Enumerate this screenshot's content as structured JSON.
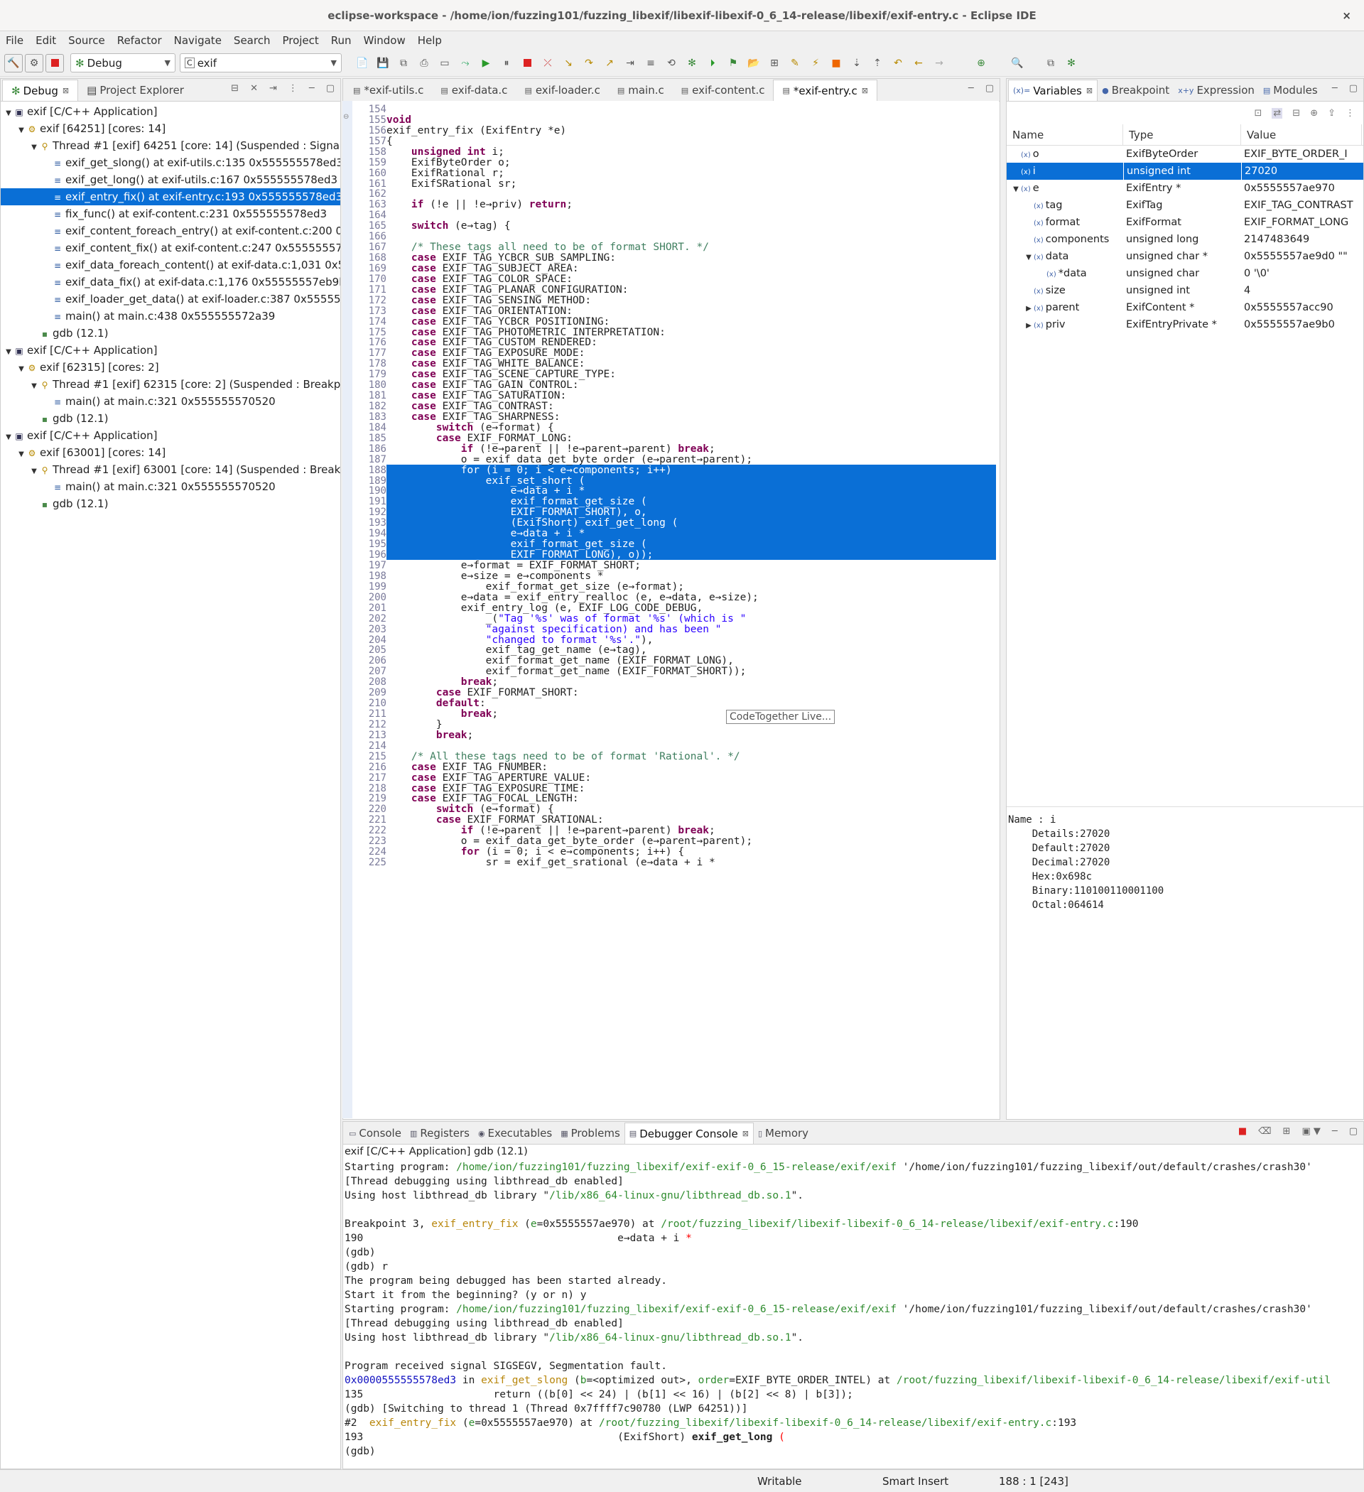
{
  "window": {
    "title": "eclipse-workspace - /home/ion/fuzzing101/fuzzing_libexif/libexif-libexif-0_6_14-release/libexif/exif-entry.c - Eclipse IDE",
    "close": "×"
  },
  "menu": [
    "File",
    "Edit",
    "Source",
    "Refactor",
    "Navigate",
    "Search",
    "Project",
    "Run",
    "Window",
    "Help"
  ],
  "toolbar": {
    "perspective": "Debug",
    "launch_config": "exif"
  },
  "debug_view": {
    "tabs": [
      "Debug",
      "Project Explorer"
    ],
    "rows": [
      {
        "indent": 0,
        "twisty": "▼",
        "icon": "c-app-icon",
        "text": "exif [C/C++ Application]"
      },
      {
        "indent": 1,
        "twisty": "▼",
        "icon": "process-icon",
        "text": "exif [64251] [cores: 14]"
      },
      {
        "indent": 2,
        "twisty": "▼",
        "icon": "thread-icon",
        "text": "Thread #1 [exif] 64251 [core: 14] (Suspended : Signal"
      },
      {
        "indent": 3,
        "twisty": "",
        "icon": "frame-icon",
        "text": "exif_get_slong() at exif-utils.c:135 0x555555578ed3"
      },
      {
        "indent": 3,
        "twisty": "",
        "icon": "frame-icon",
        "text": "exif_get_long() at exif-utils.c:167 0x555555578ed3"
      },
      {
        "indent": 3,
        "twisty": "",
        "icon": "frame-icon",
        "text": "exif_entry_fix() at exif-entry.c:193 0x555555578ed3",
        "selected": true
      },
      {
        "indent": 3,
        "twisty": "",
        "icon": "frame-icon",
        "text": "fix_func() at exif-content.c:231 0x555555578ed3"
      },
      {
        "indent": 3,
        "twisty": "",
        "icon": "frame-icon",
        "text": "exif_content_foreach_entry() at exif-content.c:200 0x"
      },
      {
        "indent": 3,
        "twisty": "",
        "icon": "frame-icon",
        "text": "exif_content_fix() at exif-content.c:247 0x555555578"
      },
      {
        "indent": 3,
        "twisty": "",
        "icon": "frame-icon",
        "text": "exif_data_foreach_content() at exif-data.c:1,031 0x55"
      },
      {
        "indent": 3,
        "twisty": "",
        "icon": "frame-icon",
        "text": "exif_data_fix() at exif-data.c:1,176 0x55555557eb9b"
      },
      {
        "indent": 3,
        "twisty": "",
        "icon": "frame-icon",
        "text": "exif_loader_get_data() at exif-loader.c:387 0x555555"
      },
      {
        "indent": 3,
        "twisty": "",
        "icon": "frame-icon",
        "text": "main() at main.c:438 0x555555572a39"
      },
      {
        "indent": 2,
        "twisty": "",
        "icon": "gdb-icon",
        "text": "gdb (12.1)"
      },
      {
        "indent": 0,
        "twisty": "▼",
        "icon": "c-app-icon",
        "text": "exif [C/C++ Application]"
      },
      {
        "indent": 1,
        "twisty": "▼",
        "icon": "process-icon",
        "text": "exif [62315] [cores: 2]"
      },
      {
        "indent": 2,
        "twisty": "▼",
        "icon": "thread-icon",
        "text": "Thread #1 [exif] 62315 [core: 2] (Suspended : Breakpo"
      },
      {
        "indent": 3,
        "twisty": "",
        "icon": "frame-icon",
        "text": "main() at main.c:321 0x555555570520"
      },
      {
        "indent": 2,
        "twisty": "",
        "icon": "gdb-icon",
        "text": "gdb (12.1)"
      },
      {
        "indent": 0,
        "twisty": "▼",
        "icon": "c-app-icon",
        "text": "exif [C/C++ Application]"
      },
      {
        "indent": 1,
        "twisty": "▼",
        "icon": "process-icon",
        "text": "exif [63001] [cores: 14]"
      },
      {
        "indent": 2,
        "twisty": "▼",
        "icon": "thread-icon",
        "text": "Thread #1 [exif] 63001 [core: 14] (Suspended : Breakp"
      },
      {
        "indent": 3,
        "twisty": "",
        "icon": "frame-icon",
        "text": "main() at main.c:321 0x555555570520"
      },
      {
        "indent": 2,
        "twisty": "",
        "icon": "gdb-icon",
        "text": "gdb (12.1)"
      }
    ]
  },
  "editor": {
    "tabs": [
      {
        "label": "*exif-utils.c",
        "active": false
      },
      {
        "label": "exif-data.c",
        "active": false
      },
      {
        "label": "exif-loader.c",
        "active": false
      },
      {
        "label": "main.c",
        "active": false
      },
      {
        "label": "exif-content.c",
        "active": false
      },
      {
        "label": "*exif-entry.c",
        "active": true
      }
    ],
    "first_line": 154,
    "highlight": {
      "from": 188,
      "to": 196
    },
    "lines": [
      "",
      "void",
      "exif_entry_fix (ExifEntry *e)",
      "{",
      "    unsigned int i;",
      "    ExifByteOrder o;",
      "    ExifRational r;",
      "    ExifSRational sr;",
      "",
      "    if (!e || !e→priv) return;",
      "",
      "    switch (e→tag) {",
      "",
      "    /* These tags all need to be of format SHORT. */",
      "    case EXIF_TAG_YCBCR_SUB_SAMPLING:",
      "    case EXIF_TAG_SUBJECT_AREA:",
      "    case EXIF_TAG_COLOR_SPACE:",
      "    case EXIF_TAG_PLANAR_CONFIGURATION:",
      "    case EXIF_TAG_SENSING_METHOD:",
      "    case EXIF_TAG_ORIENTATION:",
      "    case EXIF_TAG_YCBCR_POSITIONING:",
      "    case EXIF_TAG_PHOTOMETRIC_INTERPRETATION:",
      "    case EXIF_TAG_CUSTOM_RENDERED:",
      "    case EXIF_TAG_EXPOSURE_MODE:",
      "    case EXIF_TAG_WHITE_BALANCE:",
      "    case EXIF_TAG_SCENE_CAPTURE_TYPE:",
      "    case EXIF_TAG_GAIN_CONTROL:",
      "    case EXIF_TAG_SATURATION:",
      "    case EXIF_TAG_CONTRAST:",
      "    case EXIF_TAG_SHARPNESS:",
      "        switch (e→format) {",
      "        case EXIF_FORMAT_LONG:",
      "            if (!e→parent || !e→parent→parent) break;",
      "            o = exif_data_get_byte_order (e→parent→parent);",
      "            for (i = 0; i < e→components; i++)",
      "                exif_set_short (",
      "                    e→data + i *",
      "                    exif_format_get_size (",
      "                    EXIF_FORMAT_SHORT), o,",
      "                    (ExifShort) exif_get_long (",
      "                    e→data + i *",
      "                    exif_format_get_size (",
      "                    EXIF_FORMAT_LONG), o));",
      "            e→format = EXIF_FORMAT_SHORT;",
      "            e→size = e→components *",
      "                exif_format_get_size (e→format);",
      "            e→data = exif_entry_realloc (e, e→data, e→size);",
      "            exif_entry_log (e, EXIF_LOG_CODE_DEBUG,",
      "                _(\"Tag '%s' was of format '%s' (which is \"",
      "                \"against specification) and has been \"",
      "                \"changed to format '%s'.\"),",
      "                exif_tag_get_name (e→tag),",
      "                exif_format_get_name (EXIF_FORMAT_LONG),",
      "                exif_format_get_name (EXIF_FORMAT_SHORT));",
      "            break;",
      "        case EXIF_FORMAT_SHORT:",
      "        default:",
      "            break;",
      "        }",
      "        break;",
      "",
      "    /* All these tags need to be of format 'Rational'. */",
      "    case EXIF_TAG_FNUMBER:",
      "    case EXIF_TAG_APERTURE_VALUE:",
      "    case EXIF_TAG_EXPOSURE_TIME:",
      "    case EXIF_TAG_FOCAL_LENGTH:",
      "        switch (e→format) {",
      "        case EXIF_FORMAT_SRATIONAL:",
      "            if (!e→parent || !e→parent→parent) break;",
      "            o = exif_data_get_byte_order (e→parent→parent);",
      "            for (i = 0; i < e→components; i++) {",
      "                sr = exif_get_srational (e→data + i *"
    ],
    "hover_tip": "CodeTogether Live..."
  },
  "variables_view": {
    "tabs": [
      "Variables",
      "Breakpoint",
      "Expression",
      "Modules"
    ],
    "columns": [
      "Name",
      "Type",
      "Value"
    ],
    "rows": [
      {
        "indent": 0,
        "twisty": "",
        "name": "o",
        "type": "ExifByteOrder",
        "value": "EXIF_BYTE_ORDER_I"
      },
      {
        "indent": 0,
        "twisty": "",
        "name": "i",
        "type": "unsigned int",
        "value": "27020",
        "selected": true
      },
      {
        "indent": 0,
        "twisty": "▼",
        "name": "e",
        "type": "ExifEntry *",
        "value": "0x5555557ae970"
      },
      {
        "indent": 1,
        "twisty": "",
        "name": "tag",
        "type": "ExifTag",
        "value": "EXIF_TAG_CONTRAST"
      },
      {
        "indent": 1,
        "twisty": "",
        "name": "format",
        "type": "ExifFormat",
        "value": "EXIF_FORMAT_LONG"
      },
      {
        "indent": 1,
        "twisty": "",
        "name": "components",
        "type": "unsigned long",
        "value": "2147483649"
      },
      {
        "indent": 1,
        "twisty": "▼",
        "name": "data",
        "type": "unsigned char *",
        "value": "0x5555557ae9d0 \"\""
      },
      {
        "indent": 2,
        "twisty": "",
        "name": "*data",
        "type": "unsigned char",
        "value": "0 '\\0'"
      },
      {
        "indent": 1,
        "twisty": "",
        "name": "size",
        "type": "unsigned int",
        "value": "4"
      },
      {
        "indent": 1,
        "twisty": "▶",
        "name": "parent",
        "type": "ExifContent *",
        "value": "0x5555557acc90"
      },
      {
        "indent": 1,
        "twisty": "▶",
        "name": "priv",
        "type": "ExifEntryPrivate *",
        "value": "0x5555557ae9b0"
      }
    ],
    "details": [
      "Name : i",
      "    Details:27020",
      "    Default:27020",
      "    Decimal:27020",
      "    Hex:0x698c",
      "    Binary:110100110001100",
      "    Octal:064614"
    ]
  },
  "console_view": {
    "tabs": [
      "Console",
      "Registers",
      "Executables",
      "Problems",
      "Debugger Console",
      "Memory"
    ],
    "active_tab": "Debugger Console",
    "header": "exif [C/C++ Application] gdb (12.1)",
    "lines": [
      [
        [
          "Starting program: ",
          ""
        ],
        [
          "/home/ion/fuzzing101/fuzzing_libexif/exif-exif-0_6_15-release/exif/exif",
          "path"
        ],
        [
          " '/home/ion/fuzzing101/fuzzing_libexif/out/default/crashes/crash30'",
          ""
        ]
      ],
      [
        [
          "[Thread debugging using libthread_db enabled]",
          ""
        ]
      ],
      [
        [
          "Using host libthread_db library \"",
          ""
        ],
        [
          "/lib/x86_64-linux-gnu/libthread_db.so.1",
          "path"
        ],
        [
          "\".",
          ""
        ]
      ],
      [
        [
          "",
          ""
        ]
      ],
      [
        [
          "Breakpoint 3, ",
          ""
        ],
        [
          "exif_entry_fix",
          "fn"
        ],
        [
          " (",
          ""
        ],
        [
          "e",
          "path"
        ],
        [
          "=0x5555557ae970) at ",
          ""
        ],
        [
          "/root/fuzzing_libexif/libexif-libexif-0_6_14-release/libexif/exif-entry.c",
          "path"
        ],
        [
          ":190",
          ""
        ]
      ],
      [
        [
          "190                                         e→data + i ",
          ""
        ],
        [
          "*",
          "num"
        ]
      ],
      [
        [
          "(gdb)",
          ""
        ]
      ],
      [
        [
          "(gdb) r",
          ""
        ]
      ],
      [
        [
          "The program being debugged has been started already.",
          ""
        ]
      ],
      [
        [
          "Start it from the beginning? (y or n) y",
          ""
        ]
      ],
      [
        [
          "Starting program: ",
          ""
        ],
        [
          "/home/ion/fuzzing101/fuzzing_libexif/exif-exif-0_6_15-release/exif/exif",
          "path"
        ],
        [
          " '/home/ion/fuzzing101/fuzzing_libexif/out/default/crashes/crash30'",
          ""
        ]
      ],
      [
        [
          "[Thread debugging using libthread_db enabled]",
          ""
        ]
      ],
      [
        [
          "Using host libthread_db library \"",
          ""
        ],
        [
          "/lib/x86_64-linux-gnu/libthread_db.so.1",
          "path"
        ],
        [
          "\".",
          ""
        ]
      ],
      [
        [
          "",
          ""
        ]
      ],
      [
        [
          "Program received signal SIGSEGV, Segmentation fault.",
          ""
        ]
      ],
      [
        [
          "0x0000555555578ed3",
          "addr"
        ],
        [
          " in ",
          ""
        ],
        [
          "exif_get_slong",
          "fn"
        ],
        [
          " (",
          ""
        ],
        [
          "b",
          "path"
        ],
        [
          "=<optimized out>, ",
          ""
        ],
        [
          "order",
          "path"
        ],
        [
          "=EXIF_BYTE_ORDER_INTEL) at ",
          ""
        ],
        [
          "/root/fuzzing_libexif/libexif-libexif-0_6_14-release/libexif/exif-util",
          "path"
        ]
      ],
      [
        [
          "135                     return ((b[0] << 24) | (b[1] << 16) | (b[2] << 8) | b[3]);",
          ""
        ]
      ],
      [
        [
          "(gdb) [Switching to thread 1 (Thread 0x7ffff7c90780 (LWP 64251))]",
          ""
        ]
      ],
      [
        [
          "#2  ",
          ""
        ],
        [
          "exif_entry_fix",
          "fn"
        ],
        [
          " (",
          ""
        ],
        [
          "e",
          "path"
        ],
        [
          "=0x5555557ae970) at ",
          ""
        ],
        [
          "/root/fuzzing_libexif/libexif-libexif-0_6_14-release/libexif/exif-entry.c",
          "path"
        ],
        [
          ":193",
          ""
        ]
      ],
      [
        [
          "193                                         (ExifShort) ",
          ""
        ],
        [
          "exif_get_long",
          "bold"
        ],
        [
          " ",
          ""
        ],
        [
          "(",
          "num"
        ]
      ],
      [
        [
          "(gdb)",
          ""
        ]
      ]
    ]
  },
  "status": {
    "writable": "Writable",
    "insert_mode": "Smart Insert",
    "position": "188 : 1 [243]"
  }
}
